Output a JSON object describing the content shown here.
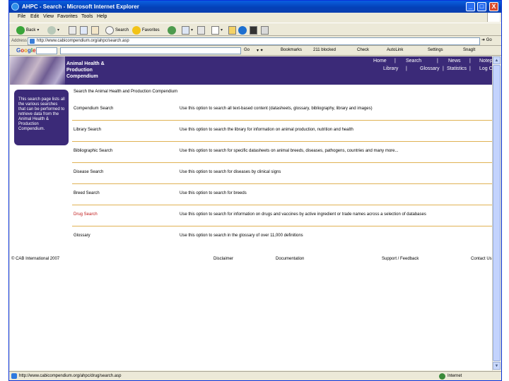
{
  "window": {
    "title": "AHPC - Search - Microsoft Internet Explorer",
    "controls": [
      "_",
      "□",
      "X"
    ]
  },
  "menubar": [
    "File",
    "Edit",
    "View",
    "Favorites",
    "Tools",
    "Help"
  ],
  "toolbar": {
    "back": "Back",
    "search": "Search",
    "favorites": "Favorites"
  },
  "addressbar": {
    "label": "Address",
    "url": "http://www.cabicompendium.org/ahpc/search.asp",
    "go": "Go"
  },
  "googlebar": {
    "logo": "Google",
    "go": "Go",
    "bookmarks": "Bookmarks",
    "blocked": "211 blocked",
    "check": "Check",
    "autolink": "AutoLink",
    "settings": "Settings",
    "snagit": "SnagIt"
  },
  "page": {
    "site_title": [
      "Animal Health &",
      "Production",
      "Compendium"
    ],
    "nav_top": [
      "Home",
      "|",
      "Search",
      "|",
      "News",
      "|",
      "Notepad"
    ],
    "nav_bottom": [
      "Library",
      "|",
      "Glossary",
      "|",
      "Statistics",
      "|",
      "Log Off"
    ],
    "sidebox_text": "This search page lists all the various searches that can be performed to retrieve data from the Animal Health & Production Compendium.",
    "content_title": "Search the Animal Health and Production Compendium",
    "rows": [
      {
        "name": "Compendium Search",
        "desc": "Use this option to search all text-based content (datasheets, glossary, bibliography, library and images)"
      },
      {
        "name": "Library Search",
        "desc": "Use this option to search the library for information on animal production, nutrition and health"
      },
      {
        "name": "Bibliographic Search",
        "desc": "Use this option to search for specific datasheets on animal breeds, diseases, pathogens, countries and many more..."
      },
      {
        "name": "Disease Search",
        "desc": "Use this option to search for diseases by clinical signs"
      },
      {
        "name": "Breed Search",
        "desc": "Use this option to search for breeds"
      },
      {
        "name": "Drug Search",
        "desc": "Use this option to search for information on drugs and vaccines by active ingredient or trade names across a selection of databases"
      },
      {
        "name": "Glossary",
        "desc": "Use this option to search in the glossary of over 11,000 definitions"
      }
    ],
    "active_row": 5,
    "footer": {
      "copyright": "© CAB International 2007",
      "disclaimer": "Disclaimer",
      "documentation": "Documentation",
      "support": "Support / Feedback",
      "contact": "Contact Us"
    }
  },
  "statusbar": {
    "url": "http://www.cabicompendium.org/ahpc/drug/search.asp",
    "zone": "Internet"
  }
}
